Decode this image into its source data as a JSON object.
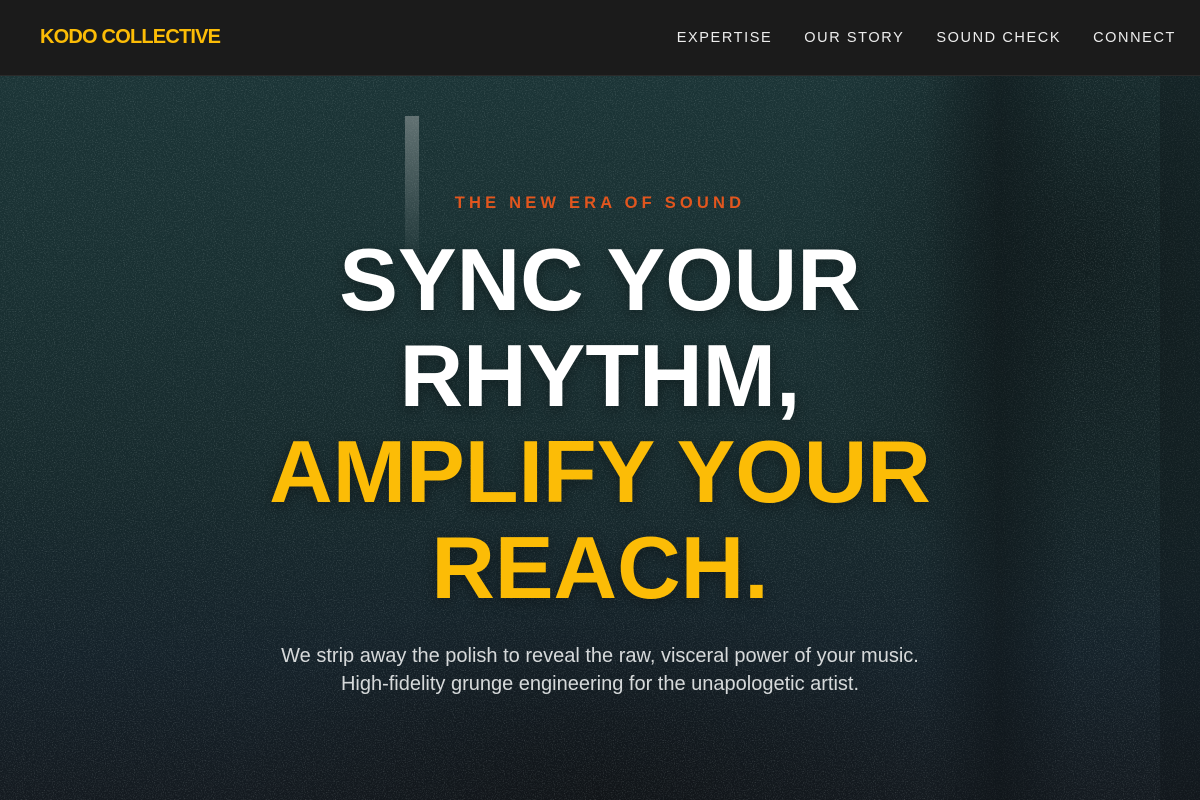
{
  "colors": {
    "brand": "#fcbc06",
    "accent_orange": "#e2561e",
    "nav_bg": "#1b1b1b",
    "headline_white": "#ffffff",
    "headline_yellow": "#fcbc06"
  },
  "nav": {
    "brand": "KODO COLLECTIVE",
    "links": [
      {
        "label": "EXPERTISE"
      },
      {
        "label": "OUR STORY"
      },
      {
        "label": "SOUND CHECK"
      },
      {
        "label": "CONNECT"
      }
    ]
  },
  "hero": {
    "eyebrow": "THE NEW ERA OF SOUND",
    "headline": {
      "line1": "SYNC YOUR",
      "line2": "RHYTHM,",
      "line3": "AMPLIFY YOUR",
      "line4": "REACH."
    },
    "subtext": {
      "line1": "We strip away the polish to reveal the raw, visceral power of your music.",
      "line2": "High-fidelity grunge engineering for the unapologetic artist."
    }
  }
}
